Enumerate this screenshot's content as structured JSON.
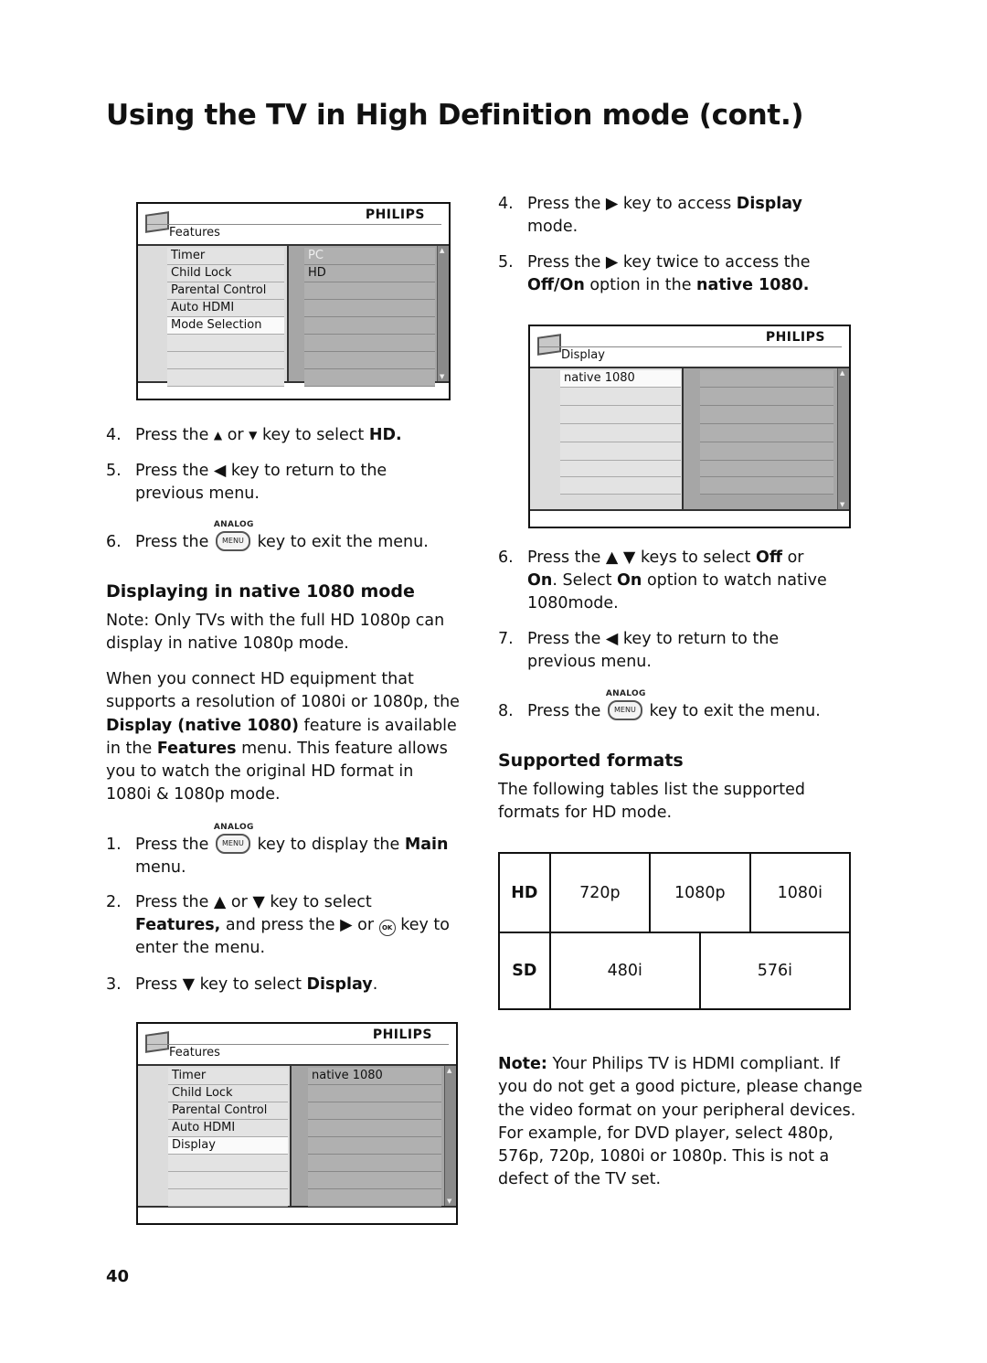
{
  "page": {
    "title": "Using the TV in High Definition mode (cont.)",
    "page_number": "40"
  },
  "menu1": {
    "brand": "PHILIPS",
    "title": "Features",
    "left_items": [
      "Timer",
      "Child Lock",
      "Parental Control",
      "Auto HDMI",
      "Mode Selection"
    ],
    "selected_left": "Mode Selection",
    "right_items": [
      "PC",
      "HD"
    ],
    "highlighted_right": "PC"
  },
  "left_steps_a": [
    {
      "num": "4.",
      "parts": [
        "Press the ",
        "▲",
        " or ",
        "▼",
        " key to select ",
        "HD."
      ]
    },
    {
      "num": "5.",
      "line1": "Press the ◀ key to return to the",
      "line2": "previous menu."
    },
    {
      "num": "6.",
      "pre": "Press the",
      "key_label": "ANALOG",
      "key": "MENU",
      "post": "key to exit the menu."
    }
  ],
  "section_native": {
    "heading": "Displaying in native 1080 mode",
    "note_lines": [
      "Note: Only TVs with the full HD 1080p can",
      "display in native 1080p mode."
    ],
    "para_lines": [
      "When you connect HD equipment that",
      "supports a resolution of 1080i or 1080p, the",
      "feature is available",
      "in the",
      "menu. This feature allows",
      "you to watch the original HD format in",
      "1080i & 1080p mode."
    ],
    "para_bold": {
      "display_native": "Display (native 1080)",
      "features": "Features"
    }
  },
  "left_steps_b": {
    "s1": {
      "num": "1.",
      "pre": "Press the",
      "key_label": "ANALOG",
      "key": "MENU",
      "post": "key to display the",
      "bold": "Main",
      "line2": "menu."
    },
    "s2": {
      "num": "2.",
      "line1": "Press the ▲ or ▼ key to select",
      "bold": "Features,",
      "mid": " and press the ▶ or ",
      "ok": "OK",
      "end": " key to",
      "line3": "enter the menu."
    },
    "s3": {
      "num": "3.",
      "pre": "Press ▼ key to select ",
      "bold": "Display",
      "post": "."
    }
  },
  "menu3": {
    "brand": "PHILIPS",
    "title": "Features",
    "left_items": [
      "Timer",
      "Child Lock",
      "Parental Control",
      "Auto HDMI",
      "Display"
    ],
    "selected_left": "Display",
    "right_items": [
      "native 1080"
    ]
  },
  "right_steps_a": {
    "s4": {
      "num": "4.",
      "pre": "Press the ▶ key to access ",
      "bold": "Display",
      "line2": "mode."
    },
    "s5": {
      "num": "5.",
      "line1": "Press the ▶ key twice to access the",
      "bold1": "Off/On",
      "mid": " option in the ",
      "bold2": "native 1080."
    }
  },
  "menu2": {
    "brand": "PHILIPS",
    "title": "Display",
    "left_items": [
      "native 1080"
    ],
    "selected_left": "native 1080"
  },
  "right_steps_b": {
    "s6": {
      "num": "6.",
      "pre": "Press the ▲ ▼ keys to select ",
      "b1": "Off",
      "post1": " or",
      "b2": "On",
      "mid": ". Select ",
      "b3": "On",
      "post2": " option to watch native",
      "line3": "1080mode."
    },
    "s7": {
      "num": "7.",
      "line1": "Press the ◀ key to return to the",
      "line2": "previous menu."
    },
    "s8": {
      "num": "8.",
      "pre": "Press the",
      "key_label": "ANALOG",
      "key": "MENU",
      "post": "key to exit the menu."
    }
  },
  "supported": {
    "heading": "Supported formats",
    "intro_lines": [
      "The following tables list the supported",
      "formats for HD mode."
    ],
    "table": {
      "hd_label": "HD",
      "hd_formats": [
        "720p",
        "1080p",
        "1080i"
      ],
      "sd_label": "SD",
      "sd_formats": [
        "480i",
        "576i"
      ]
    }
  },
  "note": {
    "label": "Note:",
    "lines": [
      " Your Philips TV is HDMI compliant. If",
      "you do not get a good picture, please change",
      "the video format on your peripheral devices.",
      "For example, for DVD player, select 480p,",
      "576p, 720p, 1080i or 1080p. This is not a",
      "defect of the TV set."
    ]
  }
}
